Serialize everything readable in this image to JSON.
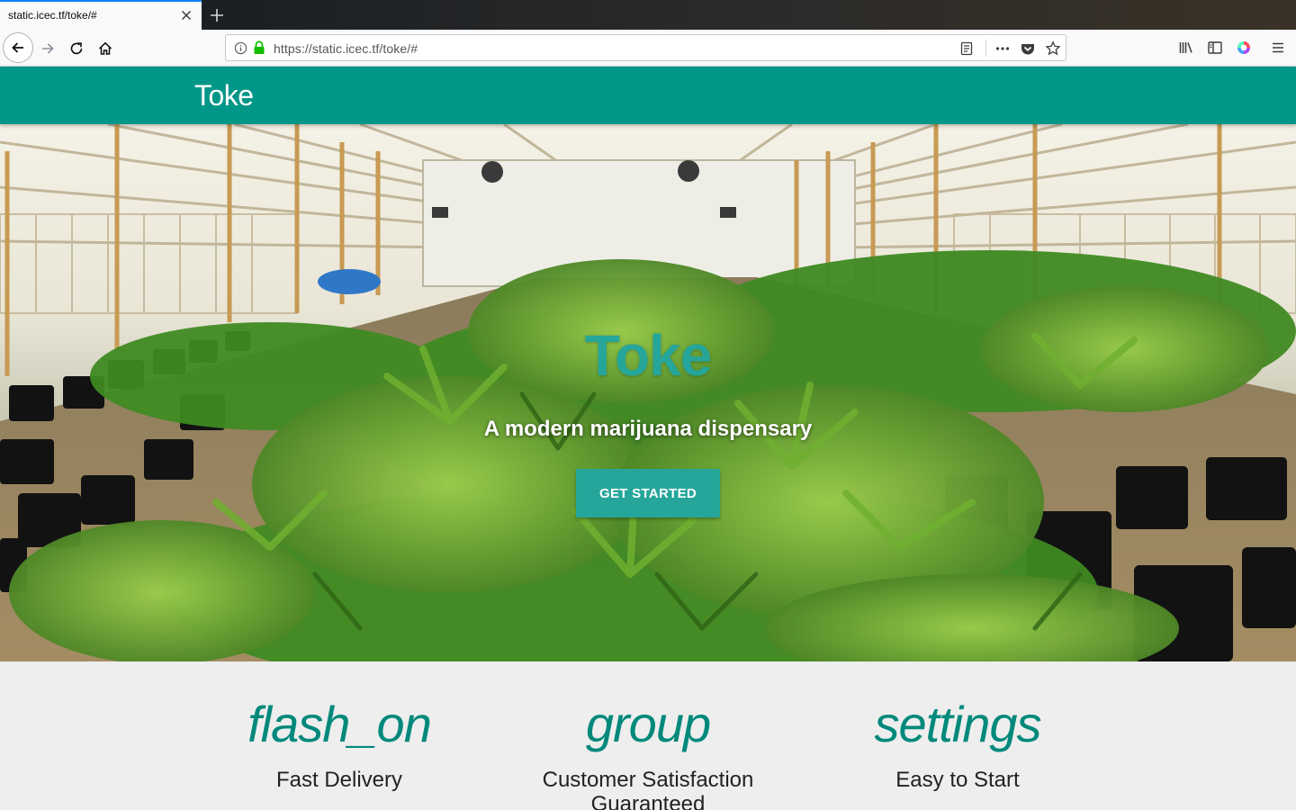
{
  "browser": {
    "tab_title": "static.icec.tf/toke/#",
    "url": "https://static.icec.tf/toke/#",
    "accent": "#0a84ff"
  },
  "header": {
    "brand": "Toke",
    "color": "#009688"
  },
  "hero": {
    "title": "Toke",
    "subtitle": "A modern marijuana dispensary",
    "cta_label": "GET STARTED",
    "accent": "#26a69a"
  },
  "features": [
    {
      "icon": "flash_on",
      "title": "Fast Delivery"
    },
    {
      "icon": "group",
      "title": "Customer Satisfaction Guaranteed"
    },
    {
      "icon": "settings",
      "title": "Easy to Start"
    }
  ]
}
